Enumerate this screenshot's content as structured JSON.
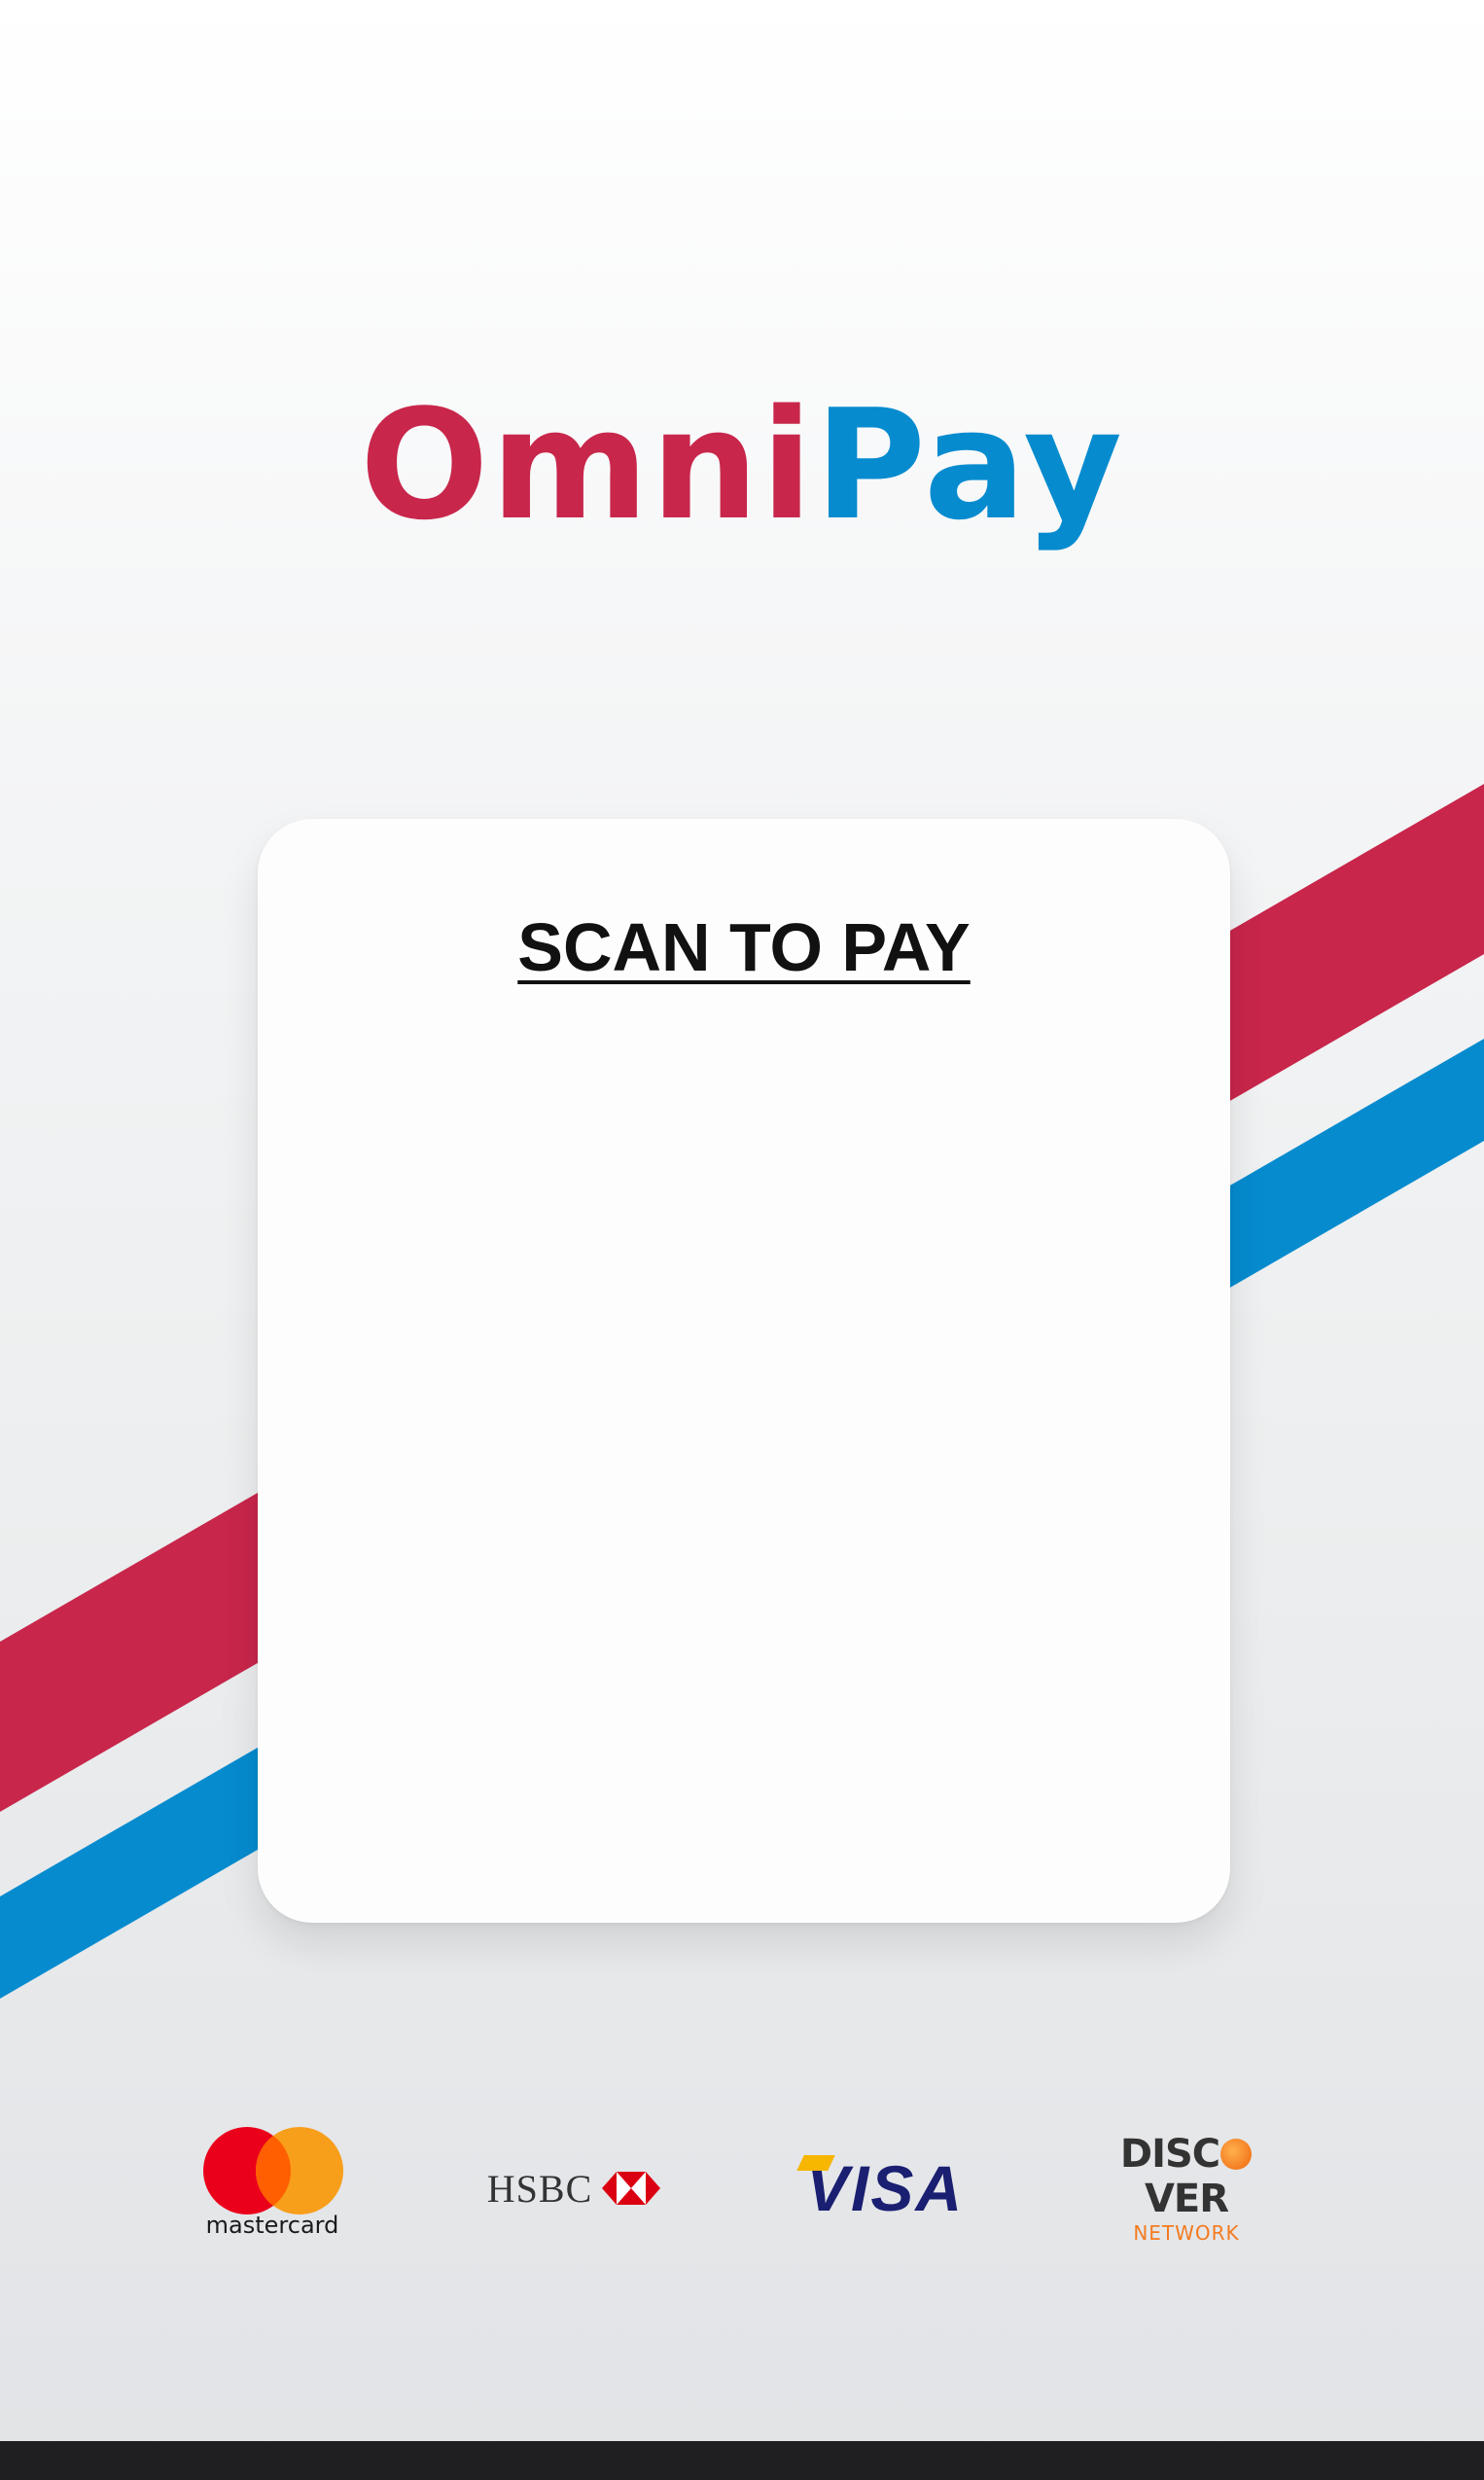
{
  "brand": {
    "name_part_1": "Omni",
    "name_part_2": "Pay",
    "color_primary": "#c8264b",
    "color_secondary": "#068bcf"
  },
  "card": {
    "title": "SCAN TO PAY"
  },
  "payment_logos": [
    {
      "name": "mastercard",
      "label": "mastercard"
    },
    {
      "name": "hsbc",
      "label": "HSBC"
    },
    {
      "name": "visa",
      "label": "VISA"
    },
    {
      "name": "discover",
      "label_top": "DISC",
      "label_top_end": "VER",
      "label_bottom": "NETWORK"
    }
  ]
}
